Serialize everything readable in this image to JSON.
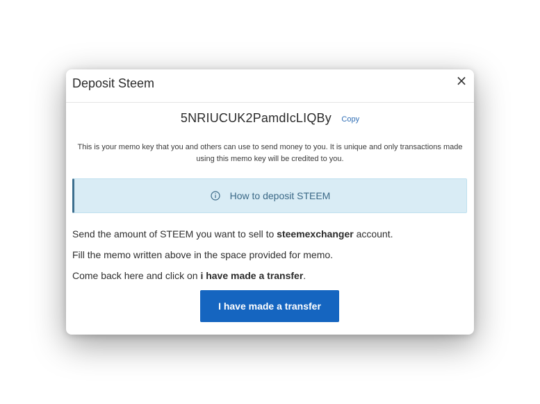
{
  "modal": {
    "title": "Deposit Steem",
    "close_label": "×"
  },
  "memo": {
    "key": "5NRIUCUK2PamdIcLIQBy",
    "copy_label": "Copy",
    "description": "This is your memo key that you and others can use to send money to you. It is unique and only transactions made using this memo key will be credited to you."
  },
  "info": {
    "icon": "info-circle-icon",
    "label": "How to deposit STEEM"
  },
  "steps": {
    "step1_pre": "Send the amount of STEEM you want to sell to ",
    "step1_bold": "steemexchanger",
    "step1_post": " account.",
    "step2": "Fill the memo written above in the space provided for memo.",
    "step3_pre": "Come back here and click on ",
    "step3_bold": "i have made a transfer",
    "step3_post": "."
  },
  "actions": {
    "transfer_label": "I have made a transfer"
  },
  "colors": {
    "primary_button": "#1565c0",
    "info_bg": "#d9ecf5",
    "info_border_accent": "#3d6f8f",
    "info_text": "#3a6886",
    "link": "#2f6eb5"
  }
}
